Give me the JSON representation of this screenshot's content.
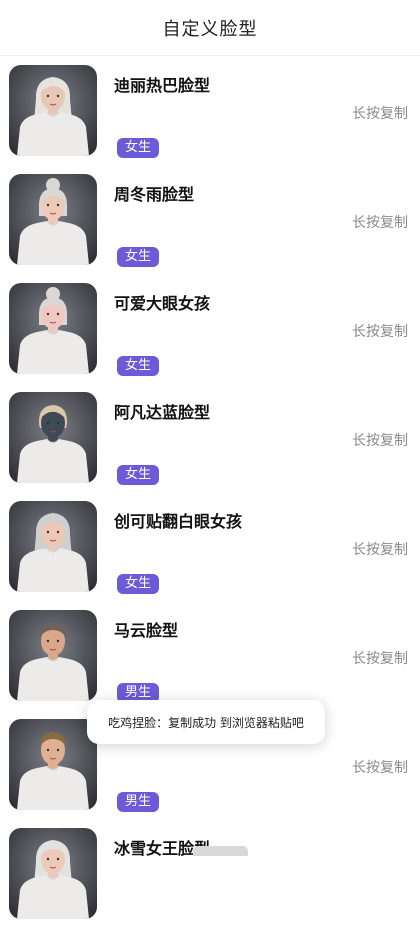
{
  "header": {
    "title": "自定义脸型"
  },
  "copy_label": "长按复制",
  "items": [
    {
      "name": "迪丽热巴脸型",
      "tag": "女生",
      "hair": "#e6e3dc",
      "skin": "#e9c7b6",
      "hair_style": "long"
    },
    {
      "name": "周冬雨脸型",
      "tag": "女生",
      "hair": "#d8d7d4",
      "skin": "#ecc9b8",
      "hair_style": "bun"
    },
    {
      "name": "可爱大眼女孩",
      "tag": "女生",
      "hair": "#ddd6d6",
      "skin": "#f0c8c2",
      "hair_style": "bun"
    },
    {
      "name": "阿凡达蓝脸型",
      "tag": "女生",
      "hair": "#d9c8a8",
      "skin": "#3f4a55",
      "hair_style": "short"
    },
    {
      "name": "创可贴翻白眼女孩",
      "tag": "女生",
      "hair": "#cfcfcf",
      "skin": "#ecc8b6",
      "hair_style": "long"
    },
    {
      "name": "马云脸型",
      "tag": "男生",
      "hair": "#6d6459",
      "skin": "#d9a88c",
      "hair_style": "male"
    },
    {
      "name": "",
      "tag": "男生",
      "hair": "#8a6a44",
      "skin": "#e0b190",
      "hair_style": "male"
    },
    {
      "name": "冰雪女王脸型",
      "tag": "",
      "hair": "#e2e2e2",
      "skin": "#ecc9b8",
      "hair_style": "long"
    }
  ],
  "toast": {
    "text": "吃鸡捏脸：复制成功 到浏览器粘贴吧"
  }
}
